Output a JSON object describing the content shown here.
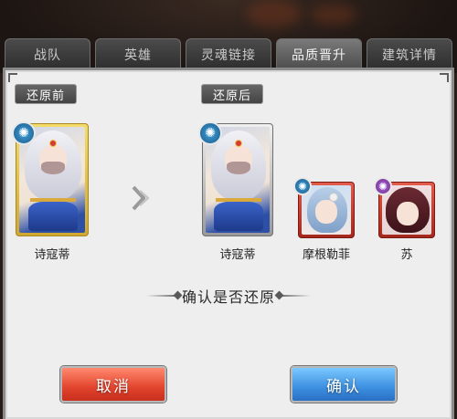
{
  "tabs": [
    {
      "label": "战队",
      "active": false
    },
    {
      "label": "英雄",
      "active": false
    },
    {
      "label": "灵魂链接",
      "active": false
    },
    {
      "label": "品质晋升",
      "active": true
    },
    {
      "label": "建筑详情",
      "active": false
    }
  ],
  "dialog": {
    "before_label": "还原前",
    "after_label": "还原后",
    "before_hero": {
      "name": "诗寇蒂",
      "badge_icon": "swirl-icon"
    },
    "after_heroes": [
      {
        "name": "诗寇蒂",
        "badge_icon": "swirl-icon"
      },
      {
        "name": "摩根勒菲",
        "badge_icon": "swirl-icon"
      },
      {
        "name": "苏",
        "badge_icon": "swirl-icon"
      }
    ],
    "prompt": "确认是否还原",
    "cancel_label": "取消",
    "confirm_label": "确认"
  },
  "colors": {
    "cancel_button": "#e2442d",
    "confirm_button": "#3d8fe0",
    "gold_frame": "#e8c84a",
    "silver_frame": "#9a9a9a",
    "red_frame": "#c0392b"
  }
}
